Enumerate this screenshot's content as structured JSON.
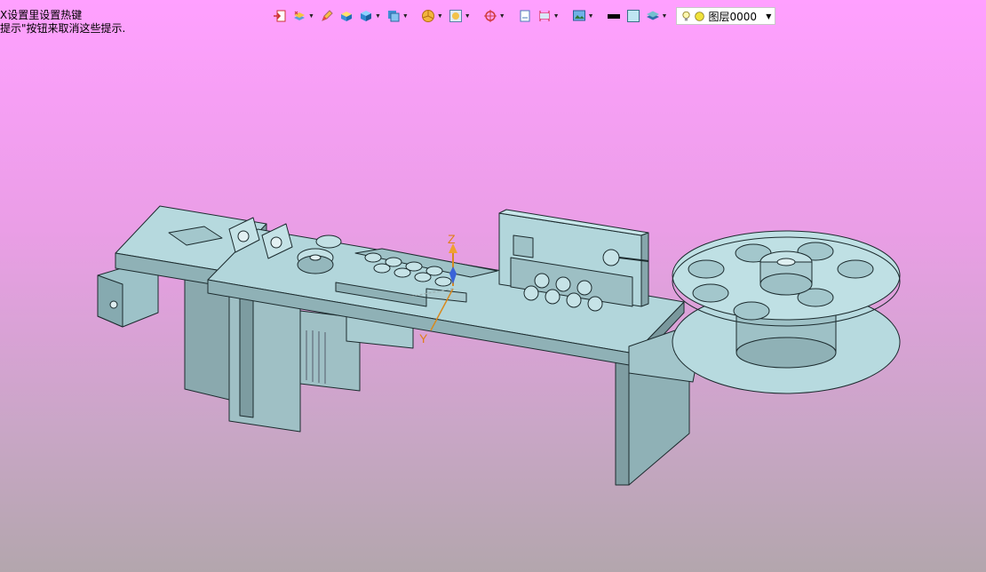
{
  "hint": {
    "line1": "X设置里设置热键",
    "line2": "提示\"按钮来取消这些提示."
  },
  "toolbar": {
    "buttons": [
      {
        "icon": "exit-sketch-icon",
        "caret": false
      },
      {
        "icon": "layers-filter-icon",
        "caret": true
      },
      {
        "icon": "pencil-icon",
        "caret": false
      },
      {
        "icon": "shaded-box-icon",
        "caret": false
      },
      {
        "icon": "render-mode-icon",
        "caret": true
      },
      {
        "icon": "view-cube-icon",
        "caret": true
      },
      {
        "icon": "pie-section-icon",
        "caret": true
      },
      {
        "icon": "display-style-icon",
        "caret": true
      },
      {
        "icon": "target-snap-icon",
        "caret": true
      },
      {
        "icon": "page-icon",
        "caret": false
      },
      {
        "icon": "dimension-icon",
        "caret": true
      },
      {
        "icon": "image-settings-icon",
        "caret": true
      },
      {
        "icon": "line-color-icon",
        "caret": false
      },
      {
        "icon": "fill-color-icon",
        "caret": false
      },
      {
        "icon": "layer-stack-icon",
        "caret": true
      }
    ],
    "layer_name": "图层0000"
  },
  "model": {
    "axis_labels": {
      "z": "Z",
      "y": "Y"
    },
    "colors": {
      "body": "#aed3d8",
      "edge": "#1c2b2e",
      "shadow": "#7a9aa0"
    }
  }
}
